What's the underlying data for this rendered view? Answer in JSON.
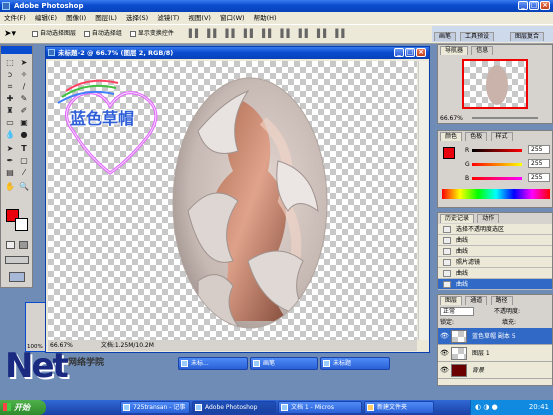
{
  "app": {
    "title": "Adobe Photoshop"
  },
  "menu": [
    "文件(F)",
    "编辑(E)",
    "图像(I)",
    "图层(L)",
    "选择(S)",
    "滤镜(T)",
    "视图(V)",
    "窗口(W)",
    "帮助(H)"
  ],
  "options": {
    "auto_select_layer": "自动选择图层",
    "auto_select_group": "自动选择组",
    "show_transform": "显示变换控件"
  },
  "wells": [
    "画笔",
    "工具预设",
    "图层复合"
  ],
  "document": {
    "title": "未标题-2 @ 66.7% (图层 2, RGB/8)",
    "zoom": "66.67%",
    "doc_size": "文档:1.25M/10.2M"
  },
  "watermark": {
    "text": "蓝色草帽"
  },
  "navigator": {
    "tabs": [
      "导航器",
      "信息"
    ],
    "zoom": "66.67%"
  },
  "color": {
    "tabs": [
      "颜色",
      "色板",
      "样式"
    ],
    "channels": [
      {
        "label": "R",
        "value": "255"
      },
      {
        "label": "G",
        "value": "255"
      },
      {
        "label": "B",
        "value": "255"
      }
    ],
    "foreground": "#e8000c",
    "background": "#ffffff"
  },
  "history": {
    "tabs": [
      "历史记录",
      "动作"
    ],
    "items": [
      "选择不透明度选区",
      "曲线",
      "曲线",
      "照片滤镜",
      "曲线",
      "曲线"
    ]
  },
  "layers": {
    "tabs": [
      "图层",
      "通道",
      "路径"
    ],
    "blend_mode": "正常",
    "opacity_label": "不透明度:",
    "lock_label": "锁定:",
    "fill_label": "填充:",
    "items": [
      "蓝色草帽 副本 5",
      "图层 1",
      "背景"
    ]
  },
  "small_window": {
    "zoom": "100%"
  },
  "taskbar": {
    "start": "开始",
    "items": [
      "未标...",
      "画笔",
      "未标题",
      "725transan - 记事",
      "Adobe Photoshop",
      "文档 1 - Micros",
      "新建文件夹"
    ],
    "clock": "20:41"
  },
  "site_logo": {
    "text": "Net",
    "subtext": "网络学院"
  }
}
